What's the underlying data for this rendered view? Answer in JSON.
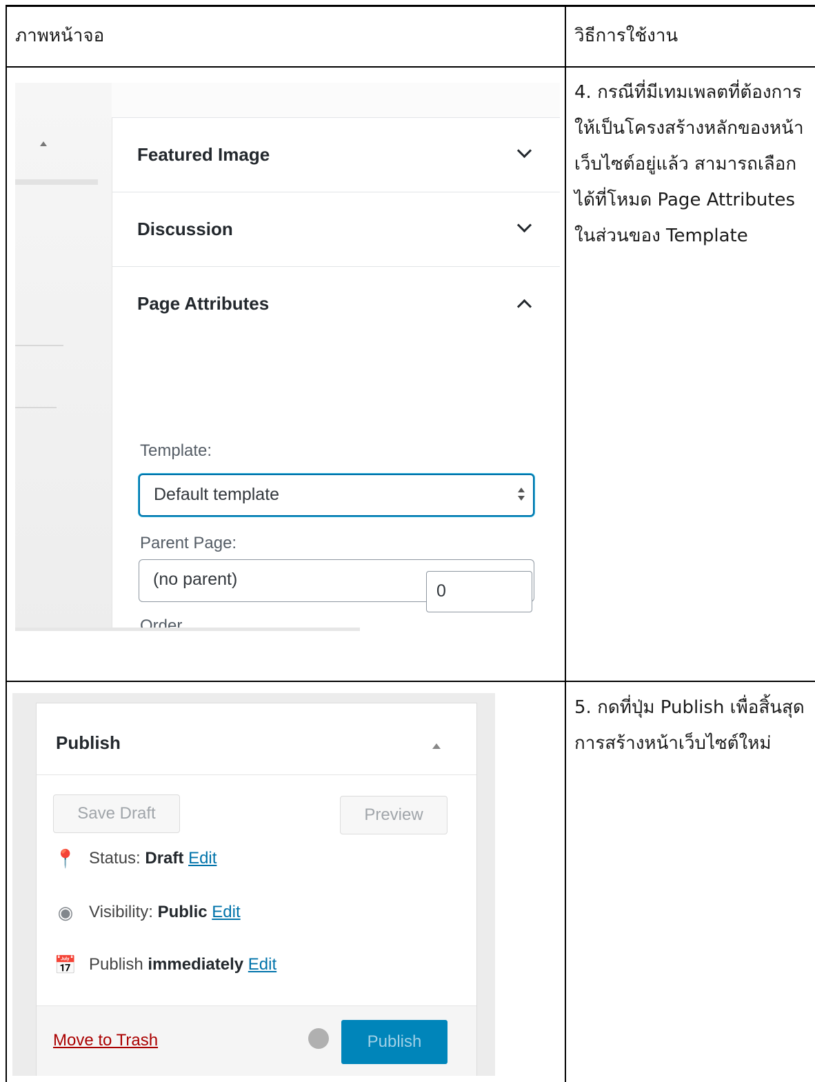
{
  "table": {
    "header_left": "ภาพหน้าจอ",
    "header_right": "วิธีการใช้งาน"
  },
  "row1": {
    "instruction": "4. กรณีที่มีเทมเพลตที่ต้องการ\nให้เป็นโครงสร้างหลักของหน้า\nเว็บไซต์อยู่แล้ว สามารถเลือก\nได้ที่โหมด Page Attributes\nในส่วนของ Template",
    "panel": {
      "featured_image": "Featured Image",
      "discussion": "Discussion",
      "page_attributes": "Page Attributes",
      "template_label": "Template:",
      "template_value": "Default template",
      "parent_label": "Parent Page:",
      "parent_value": "(no parent)",
      "order_label": "Order",
      "order_value": "0"
    }
  },
  "row2": {
    "instruction": "5. กดที่ปุ่ม Publish เพื่อสิ้นสุด\nการสร้างหน้าเว็บไซต์ใหม่",
    "publish_box": {
      "title": "Publish",
      "save_draft": "Save Draft",
      "preview": "Preview",
      "status_label": "Status: ",
      "status_value": "Draft",
      "visibility_label": "Visibility: ",
      "visibility_value": "Public",
      "publish_label": "Publish ",
      "publish_value": "immediately",
      "edit": "Edit",
      "move_to_trash": "Move to Trash",
      "publish_button": "Publish"
    }
  },
  "colors": {
    "accent": "#0073aa",
    "publish_button": "#0085ba",
    "trash": "#aa0000"
  }
}
